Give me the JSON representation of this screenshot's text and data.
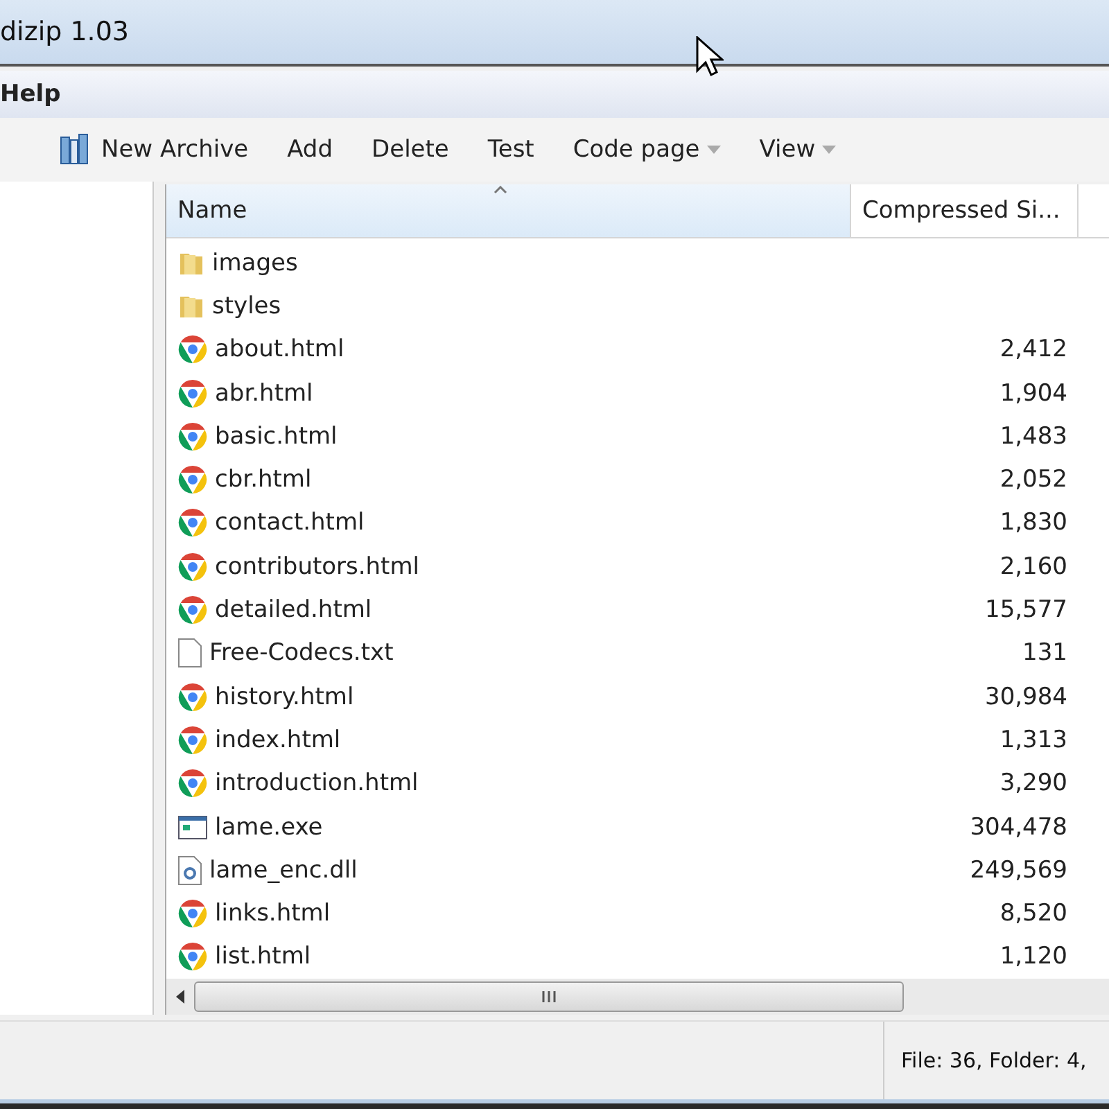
{
  "window": {
    "title": "dizip 1.03"
  },
  "menu": [
    "Help"
  ],
  "toolbar": [
    {
      "label": "New Archive",
      "kind": "icon"
    },
    {
      "label": "Add",
      "kind": "plain"
    },
    {
      "label": "Delete",
      "kind": "plain"
    },
    {
      "label": "Test",
      "kind": "plain"
    },
    {
      "label": "Code page",
      "kind": "dropdown"
    },
    {
      "label": "View",
      "kind": "dropdown"
    }
  ],
  "table": {
    "columns": [
      "Name",
      "Compressed Si..."
    ],
    "rows": [
      {
        "kind": "folder",
        "name": "images",
        "size": ""
      },
      {
        "kind": "folder",
        "name": "styles",
        "size": ""
      },
      {
        "kind": "html",
        "name": "about.html",
        "size": "2,412"
      },
      {
        "kind": "html",
        "name": "abr.html",
        "size": "1,904"
      },
      {
        "kind": "html",
        "name": "basic.html",
        "size": "1,483"
      },
      {
        "kind": "html",
        "name": "cbr.html",
        "size": "2,052"
      },
      {
        "kind": "html",
        "name": "contact.html",
        "size": "1,830"
      },
      {
        "kind": "html",
        "name": "contributors.html",
        "size": "2,160"
      },
      {
        "kind": "html",
        "name": "detailed.html",
        "size": "15,577"
      },
      {
        "kind": "text",
        "name": "Free-Codecs.txt",
        "size": "131"
      },
      {
        "kind": "html",
        "name": "history.html",
        "size": "30,984"
      },
      {
        "kind": "html",
        "name": "index.html",
        "size": "1,313"
      },
      {
        "kind": "html",
        "name": "introduction.html",
        "size": "3,290"
      },
      {
        "kind": "exe",
        "name": "lame.exe",
        "size": "304,478"
      },
      {
        "kind": "dll",
        "name": "lame_enc.dll",
        "size": "249,569"
      },
      {
        "kind": "html",
        "name": "links.html",
        "size": "8,520"
      },
      {
        "kind": "html",
        "name": "list.html",
        "size": "1,120"
      }
    ]
  },
  "status_bar": {
    "text": "File: 36, Folder: 4,"
  }
}
